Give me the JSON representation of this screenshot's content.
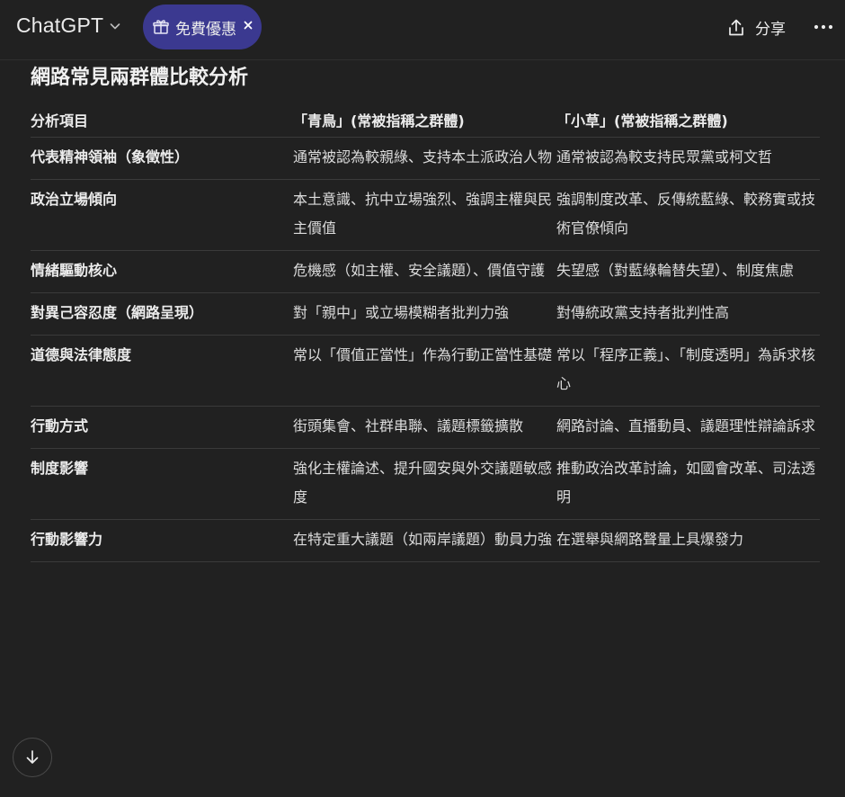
{
  "header": {
    "title": "ChatGPT",
    "promo_label": "免費優惠",
    "share_label": "分享"
  },
  "colors": {
    "background": "#212121",
    "promo_pill": "#3b3990",
    "text": "#ececec",
    "divider": "#3a3a3a"
  },
  "icons": {
    "model_dropdown": "chevron-down-icon",
    "promo": "gift-icon",
    "promo_close": "close-icon",
    "share": "share-icon",
    "more": "more-icon",
    "scroll": "arrow-down-icon"
  },
  "content": {
    "heading": "網路常見兩群體比較分析",
    "table": {
      "headers": [
        "分析項目",
        "「青鳥」(常被指稱之群體)",
        "「小草」(常被指稱之群體)"
      ],
      "rows": [
        [
          "代表精神領袖（象徵性）",
          "通常被認為較親綠、支持本土派政治人物",
          "通常被認為較支持民眾黨或柯文哲"
        ],
        [
          "政治立場傾向",
          "本土意識、抗中立場強烈、強調主權與民主價值",
          "強調制度改革、反傳統藍綠、較務實或技術官僚傾向"
        ],
        [
          "情緒驅動核心",
          "危機感（如主權、安全議題）、價值守護",
          "失望感（對藍綠輪替失望）、制度焦慮"
        ],
        [
          "對異己容忍度（網路呈現）",
          "對「親中」或立場模糊者批判力強",
          "對傳統政黨支持者批判性高"
        ],
        [
          "道德與法律態度",
          "常以「價值正當性」作為行動正當性基礎",
          "常以「程序正義」、「制度透明」為訴求核心"
        ],
        [
          "行動方式",
          "街頭集會、社群串聯、議題標籤擴散",
          "網路討論、直播動員、議題理性辯論訴求"
        ],
        [
          "制度影響",
          "強化主權論述、提升國安與外交議題敏感度",
          "推動政治改革討論，如國會改革、司法透明"
        ],
        [
          "行動影響力",
          "在特定重大議題（如兩岸議題）動員力強",
          "在選舉與網路聲量上具爆發力"
        ]
      ]
    }
  }
}
